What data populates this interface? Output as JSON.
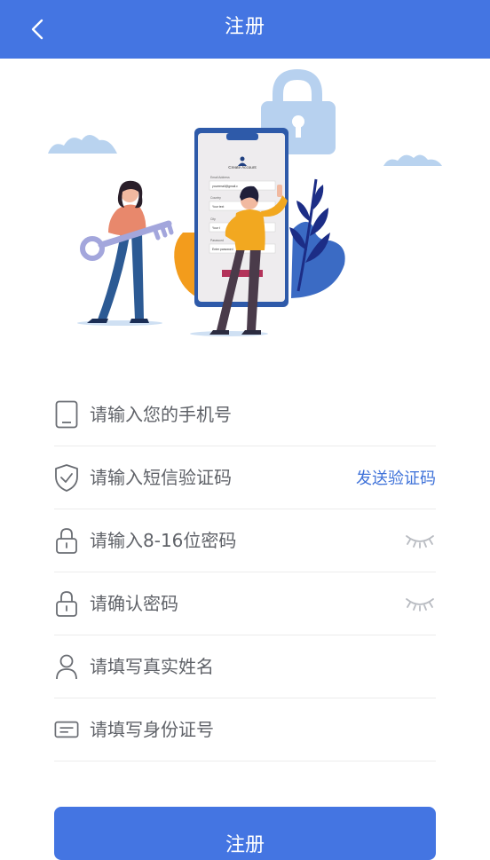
{
  "header": {
    "title": "注册",
    "back_icon": "chevron-left-icon"
  },
  "hero_illustration": {
    "screen_title": "Create Account",
    "fields": [
      "Email Address",
      "Country",
      "City",
      "Password"
    ],
    "values": [
      "youremail@gmail.c",
      "Your text",
      "Your t",
      "Enter password"
    ]
  },
  "form": {
    "phone": {
      "icon": "phone-icon",
      "placeholder": "请输入您的手机号"
    },
    "sms_code": {
      "icon": "shield-check-icon",
      "placeholder": "请输入短信验证码",
      "send_label": "发送验证码"
    },
    "password": {
      "icon": "lock-icon",
      "placeholder": "请输入8-16位密码",
      "toggle_icon": "eye-closed-icon"
    },
    "confirm_password": {
      "icon": "lock-icon",
      "placeholder": "请确认密码",
      "toggle_icon": "eye-closed-icon"
    },
    "real_name": {
      "icon": "user-icon",
      "placeholder": "请填写真实姓名"
    },
    "id_number": {
      "icon": "id-card-icon",
      "placeholder": "请填写身份证号"
    }
  },
  "submit": {
    "label": "注册"
  },
  "colors": {
    "primary": "#4475e2",
    "link": "#3f72d9",
    "divider": "#ececec",
    "placeholder": "#5f6268"
  }
}
